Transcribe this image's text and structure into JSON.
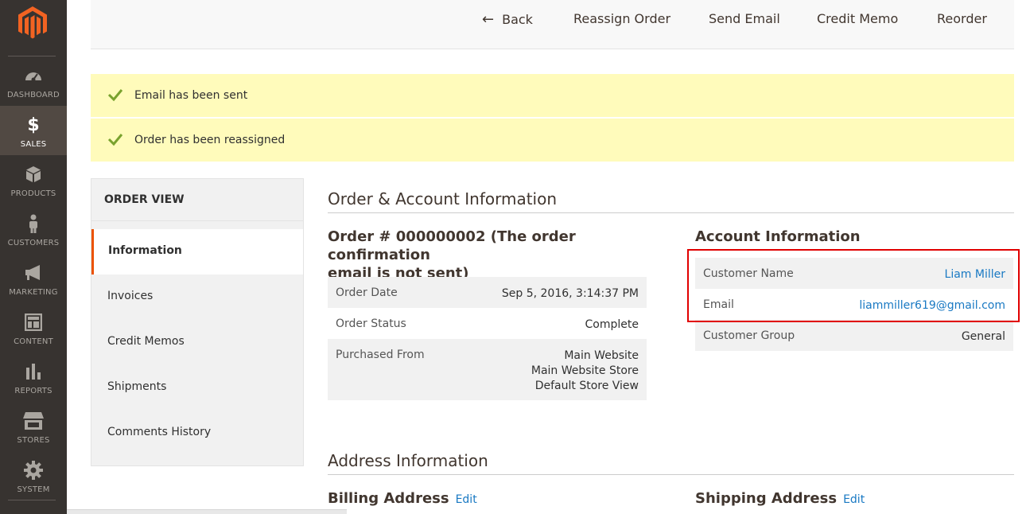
{
  "sidebar": {
    "items": [
      {
        "label": "DASHBOARD",
        "icon": "dashboard-icon"
      },
      {
        "label": "SALES",
        "icon": "dollar-icon",
        "active": true
      },
      {
        "label": "PRODUCTS",
        "icon": "box-icon"
      },
      {
        "label": "CUSTOMERS",
        "icon": "person-icon"
      },
      {
        "label": "MARKETING",
        "icon": "megaphone-icon"
      },
      {
        "label": "CONTENT",
        "icon": "layout-icon"
      },
      {
        "label": "REPORTS",
        "icon": "bar-chart-icon"
      },
      {
        "label": "STORES",
        "icon": "storefront-icon"
      },
      {
        "label": "SYSTEM",
        "icon": "gear-icon"
      }
    ]
  },
  "toolbar": {
    "back": "Back",
    "reassign": "Reassign Order",
    "send_email": "Send Email",
    "credit_memo": "Credit Memo",
    "reorder": "Reorder"
  },
  "messages": [
    "Email has been sent",
    "Order has been reassigned"
  ],
  "order_view": {
    "heading": "ORDER VIEW",
    "tabs": [
      "Information",
      "Invoices",
      "Credit Memos",
      "Shipments",
      "Comments History"
    ]
  },
  "order_account": {
    "title": "Order & Account Information",
    "order_heading_line1": "Order # 000000002 (The order confirmation",
    "order_heading_line2": "email is not sent)",
    "order_rows": [
      {
        "label": "Order Date",
        "value": "Sep 5, 2016, 3:14:37 PM"
      },
      {
        "label": "Order Status",
        "value": "Complete"
      },
      {
        "label": "Purchased From",
        "value_lines": [
          "Main Website",
          "Main Website Store",
          "Default Store View"
        ]
      }
    ],
    "account_heading": "Account Information",
    "account_rows": [
      {
        "label": "Customer Name",
        "value": "Liam Miller"
      },
      {
        "label": "Email",
        "value": "liammiller619@gmail.com"
      },
      {
        "label": "Customer Group",
        "value": "General"
      }
    ]
  },
  "address": {
    "title": "Address Information",
    "billing": "Billing Address",
    "shipping": "Shipping Address",
    "edit": "Edit"
  },
  "colors": {
    "sidebar_bg": "#373330",
    "accent": "#eb5202",
    "message_bg": "#fffbbb",
    "link": "#1979c3",
    "highlight": "#e10000"
  }
}
